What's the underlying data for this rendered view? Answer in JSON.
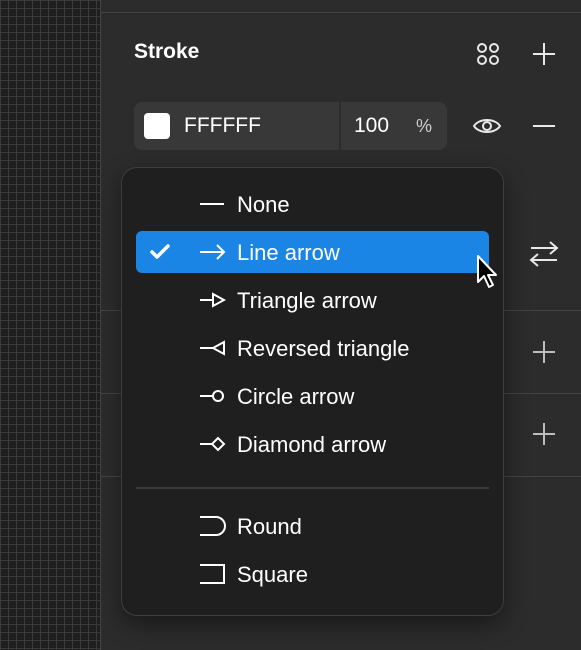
{
  "stroke": {
    "title": "Stroke",
    "color_hex": "FFFFFF",
    "swatch_color": "#ffffff",
    "opacity": "100",
    "opacity_unit": "%"
  },
  "dropdown": {
    "items": [
      {
        "label": "None",
        "icon": "none-line-icon",
        "selected": false
      },
      {
        "label": "Line arrow",
        "icon": "line-arrow-icon",
        "selected": true
      },
      {
        "label": "Triangle arrow",
        "icon": "triangle-arrow-icon",
        "selected": false
      },
      {
        "label": "Reversed triangle",
        "icon": "reversed-triangle-icon",
        "selected": false
      },
      {
        "label": "Circle arrow",
        "icon": "circle-arrow-icon",
        "selected": false
      },
      {
        "label": "Diamond arrow",
        "icon": "diamond-arrow-icon",
        "selected": false
      }
    ],
    "caps": [
      {
        "label": "Round",
        "icon": "round-cap-icon"
      },
      {
        "label": "Square",
        "icon": "square-cap-icon"
      }
    ]
  },
  "colors": {
    "selected": "#1b85e6",
    "panel": "#2c2c2c",
    "menu": "#1f1f1f"
  }
}
